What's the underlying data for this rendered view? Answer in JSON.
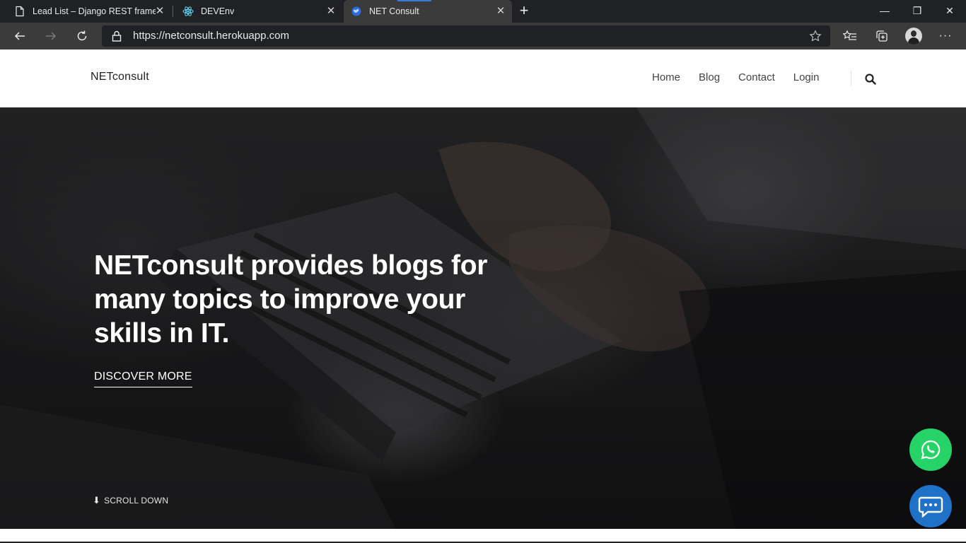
{
  "browser": {
    "tabs": [
      {
        "title": "Lead List – Django REST framewo",
        "icon": "document-icon"
      },
      {
        "title": "DEVEnv",
        "icon": "react-icon"
      },
      {
        "title": "NET Consult",
        "icon": "globe-icon",
        "active": true
      }
    ],
    "tab_close_glyph": "✕",
    "new_tab_glyph": "+",
    "window_controls": {
      "minimize": "—",
      "restore": "❐",
      "close": "✕"
    },
    "url": "https://netconsult.herokuapp.com",
    "toolbar_icons": [
      "back-icon",
      "forward-icon",
      "refresh-icon",
      "lock-icon",
      "star-icon",
      "favorites-icon",
      "collections-icon",
      "profile-avatar",
      "more-icon"
    ],
    "more_glyph": "···"
  },
  "site": {
    "logo": "NETconsult",
    "nav": [
      "Home",
      "Blog",
      "Contact",
      "Login"
    ],
    "hero": {
      "headline": "NETconsult provides blogs for many topics to improve your skills in IT.",
      "cta": "DISCOVER MORE",
      "scroll_label": "SCROLL DOWN"
    },
    "fab": {
      "whatsapp_color": "#25d366",
      "chat_color": "#1f72c7"
    }
  }
}
